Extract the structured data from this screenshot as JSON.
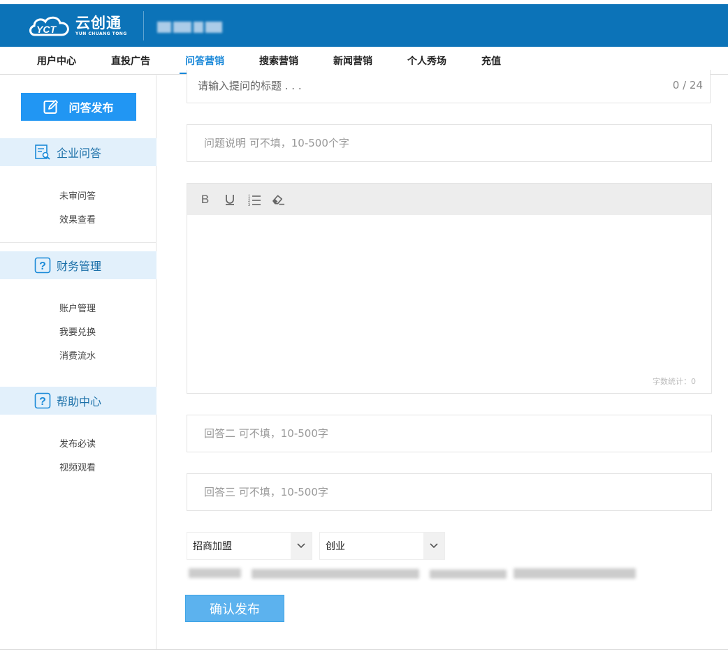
{
  "header": {
    "logo_cn": "云创通",
    "logo_en": "YUN CHUANG TONG",
    "logo_mark": "YCT"
  },
  "nav": {
    "items": [
      {
        "label": "用户中心"
      },
      {
        "label": "直投广告"
      },
      {
        "label": "问答营销",
        "active": true
      },
      {
        "label": "搜索营销"
      },
      {
        "label": "新闻营销"
      },
      {
        "label": "个人秀场"
      },
      {
        "label": "充值"
      }
    ]
  },
  "sidebar": {
    "publish_label": "问答发布",
    "sections": [
      {
        "title": "企业问答",
        "icon": "document-search-icon",
        "links": [
          "未审问答",
          "效果查看"
        ]
      },
      {
        "title": "财务管理",
        "icon": "question-icon",
        "links": [
          "账户管理",
          "我要兑换",
          "消费流水"
        ]
      },
      {
        "title": "帮助中心",
        "icon": "question-icon",
        "links": [
          "发布必读",
          "视频观看"
        ]
      }
    ]
  },
  "form": {
    "title_placeholder": "请输入提问的标题 . . .",
    "title_counter": "0 / 24",
    "desc_placeholder": "问题说明 可不填，10-500个字",
    "editor": {
      "tools": [
        "bold-icon",
        "underline-icon",
        "ordered-list-icon",
        "eraser-icon"
      ],
      "tool_bold": "B",
      "word_count": "字数统计：0"
    },
    "answer2_placeholder": "回答二 可不填，10-500字",
    "answer3_placeholder": "回答三 可不填，10-500字",
    "category1": "招商加盟",
    "category2": "创业",
    "submit_label": "确认发布"
  },
  "colors": {
    "header_bg": "#0c73b8",
    "accent": "#1686d8",
    "button_primary": "#2196f3",
    "submit": "#5cb2ee",
    "section_bg": "#e2f0fb"
  }
}
